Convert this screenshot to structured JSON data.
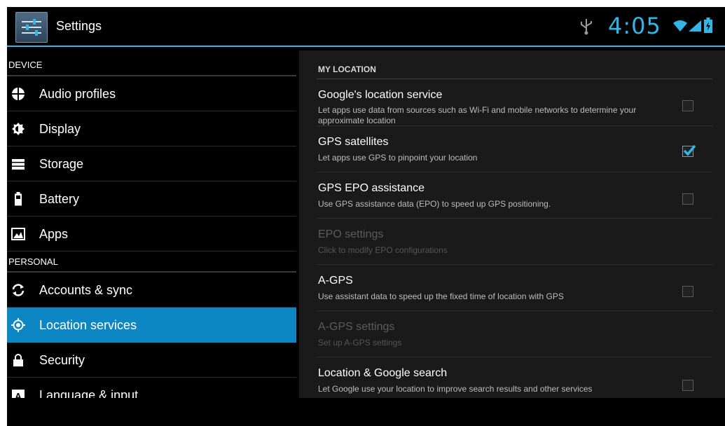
{
  "header": {
    "title": "Settings",
    "time": "4:05",
    "accent": "#33b5e5"
  },
  "sidebar": {
    "section_device": "DEVICE",
    "section_personal": "PERSONAL",
    "items": [
      {
        "label": "Audio profiles",
        "icon": "audio-profiles-icon"
      },
      {
        "label": "Display",
        "icon": "display-icon"
      },
      {
        "label": "Storage",
        "icon": "storage-icon"
      },
      {
        "label": "Battery",
        "icon": "battery-icon"
      },
      {
        "label": "Apps",
        "icon": "apps-icon"
      },
      {
        "label": "Accounts & sync",
        "icon": "sync-icon"
      },
      {
        "label": "Location services",
        "icon": "location-icon",
        "selected": true
      },
      {
        "label": "Security",
        "icon": "lock-icon"
      },
      {
        "label": "Language & input",
        "icon": "keyboard-icon"
      }
    ],
    "selected_color": "#0c87c4"
  },
  "main": {
    "section_title": "MY LOCATION",
    "prefs": [
      {
        "title": "Google's location service",
        "summary": "Let apps use data from sources such as Wi-Fi and mobile networks to determine your approximate location",
        "checked": false,
        "enabled": true
      },
      {
        "title": "GPS satellites",
        "summary": "Let apps use GPS to pinpoint your location",
        "checked": true,
        "enabled": true
      },
      {
        "title": "GPS EPO assistance",
        "summary": "Use GPS assistance data (EPO) to speed up GPS positioning.",
        "checked": false,
        "enabled": true
      },
      {
        "title": "EPO settings",
        "summary": "Click to modify EPO configurations",
        "enabled": false
      },
      {
        "title": "A-GPS",
        "summary": "Use assistant data to speed up the fixed time of location with GPS",
        "checked": false,
        "enabled": true
      },
      {
        "title": "A-GPS settings",
        "summary": "Set up A-GPS settings",
        "enabled": false
      },
      {
        "title": "Location & Google search",
        "summary": "Let Google use your location to improve search results and other services",
        "checked": false,
        "enabled": true
      }
    ]
  }
}
